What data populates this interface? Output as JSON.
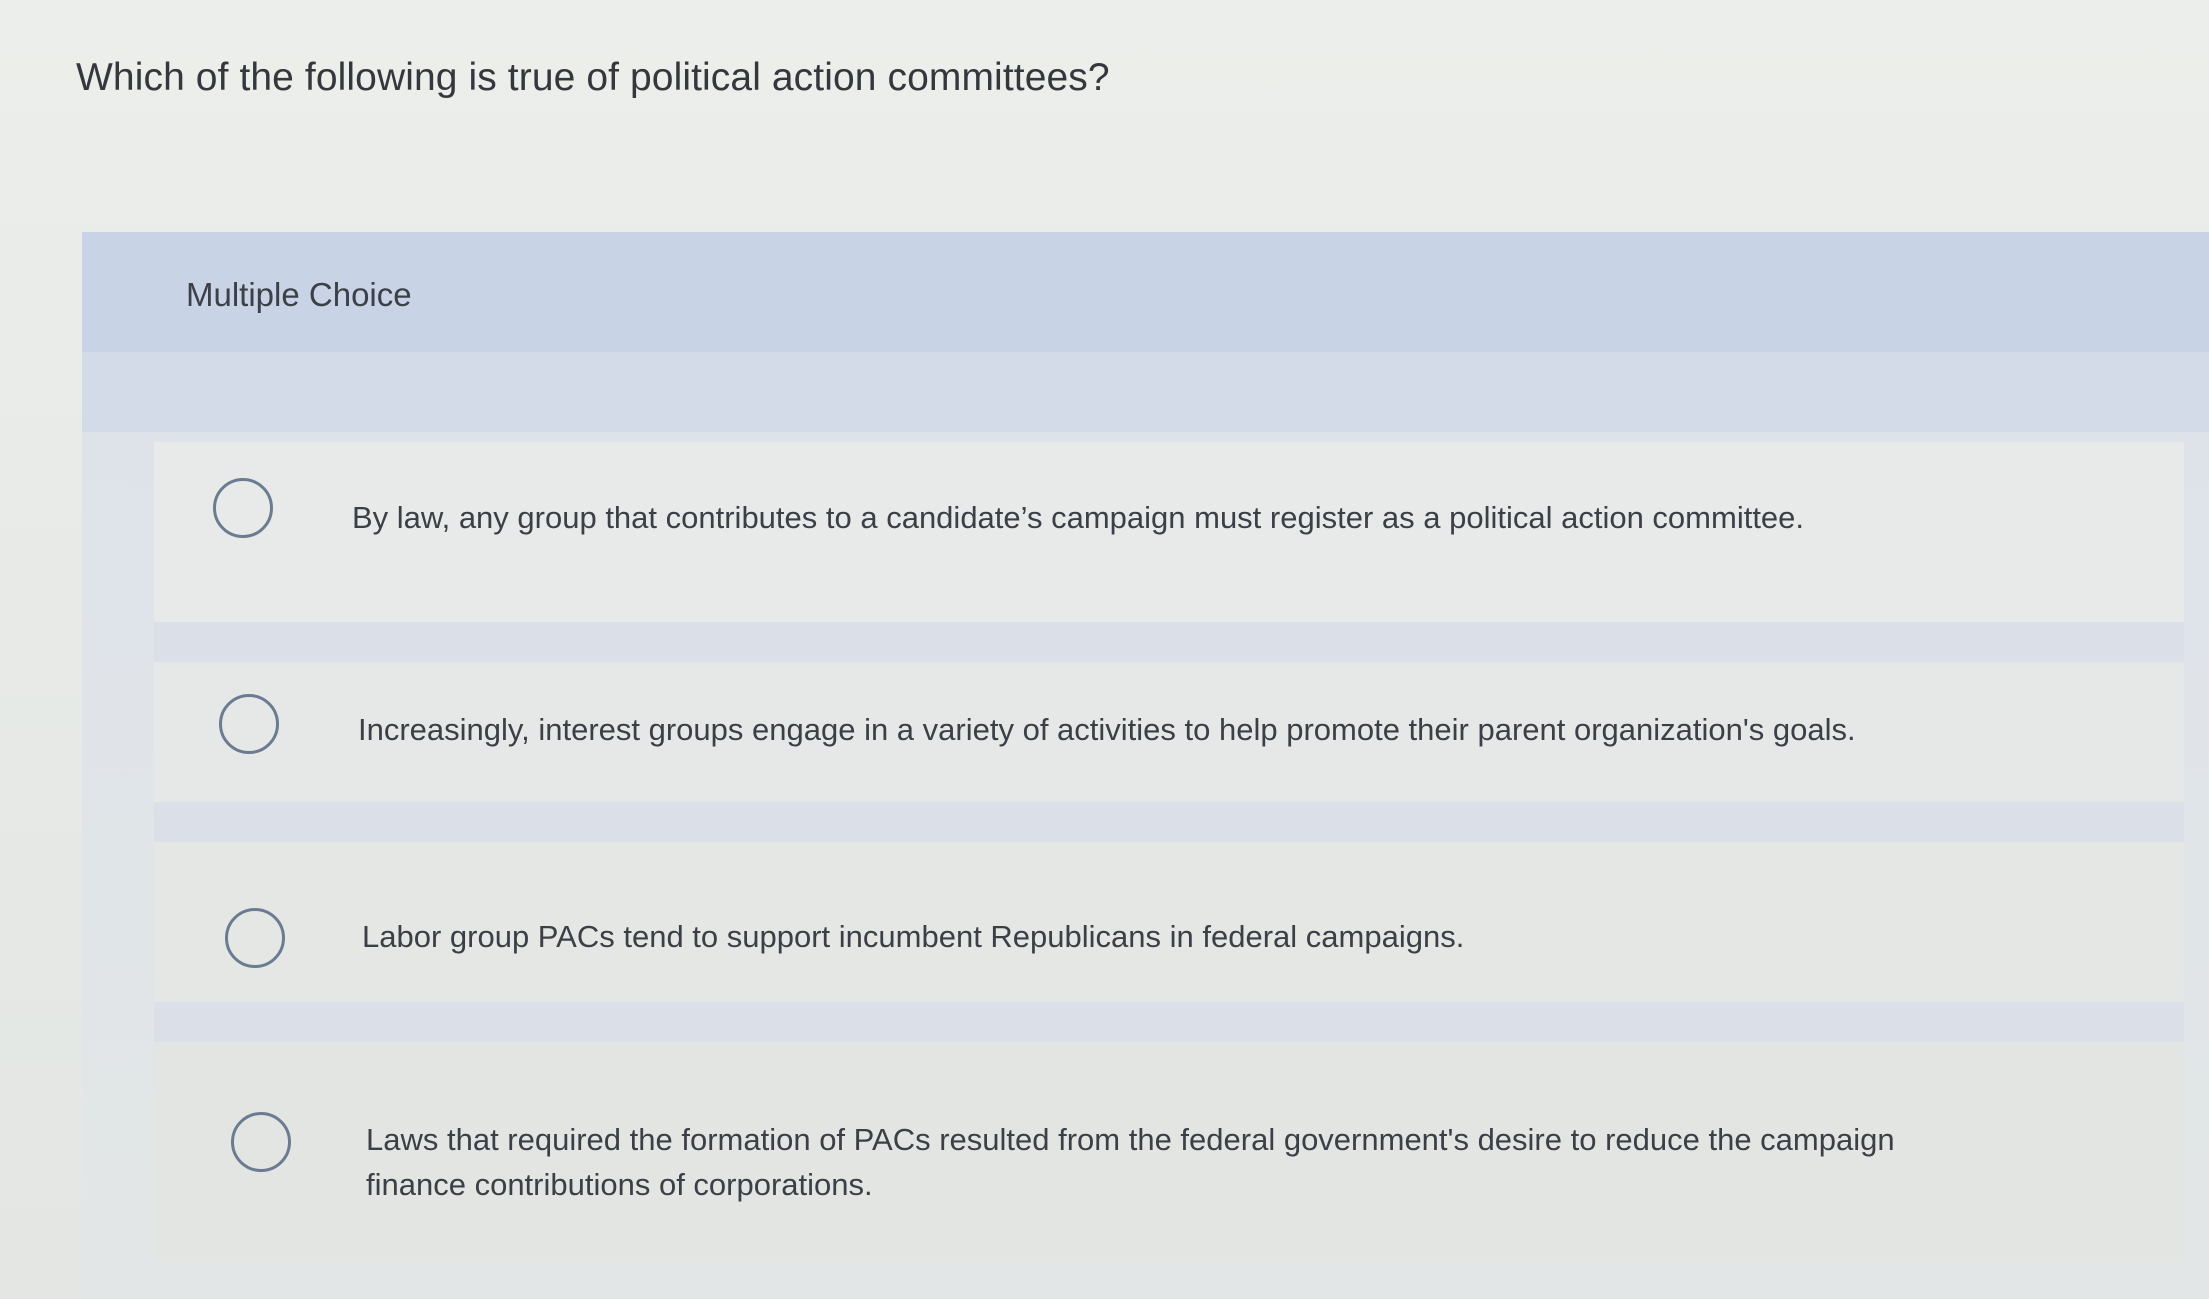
{
  "question": {
    "text": "Which of the following is true of political action committees?"
  },
  "multiple_choice": {
    "label": "Multiple Choice",
    "options": [
      {
        "text": "By law, any group that contributes to a candidate’s campaign must register as a political action committee."
      },
      {
        "text": "Increasingly, interest groups engage in a variety of activities to help promote their parent organization's goals."
      },
      {
        "text": "Labor group PACs tend to support incumbent Republicans in federal campaigns."
      },
      {
        "text": "Laws that required the formation of PACs resulted from the federal government's desire to reduce the campaign finance contributions of corporations."
      }
    ]
  },
  "colors": {
    "header_band": "#c9d3e6",
    "radio_border": "#6b7c92",
    "text": "#3b4046"
  }
}
